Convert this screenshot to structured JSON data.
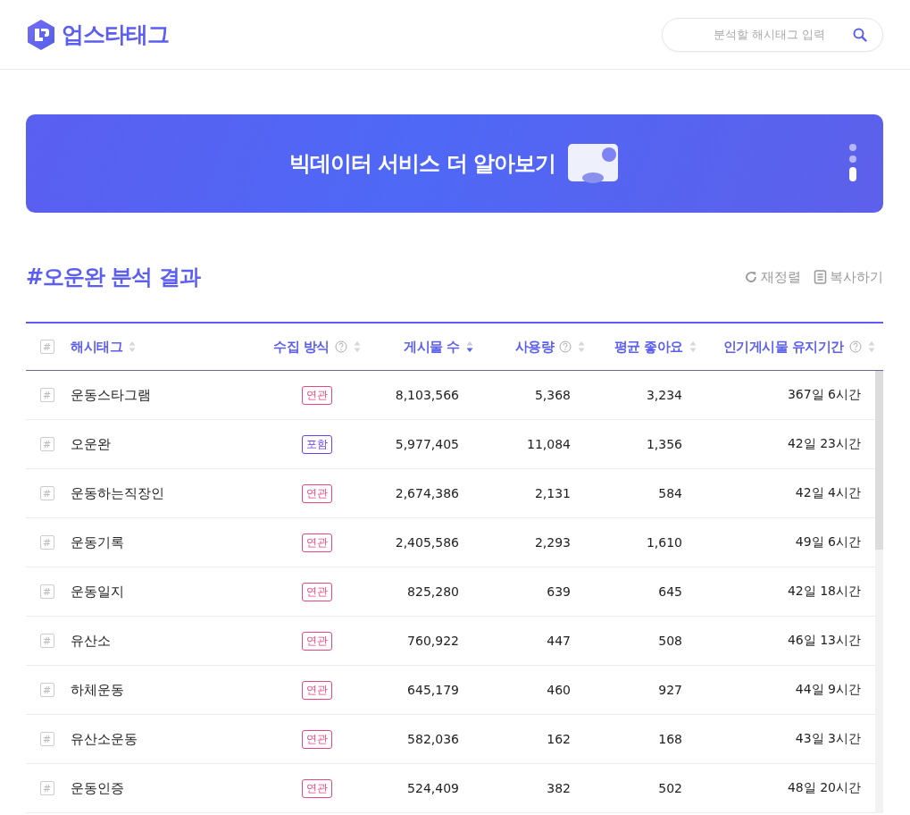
{
  "header": {
    "logo_text": "업스타태그",
    "search": {
      "placeholder": "분석할 해시태그 입력"
    }
  },
  "banner": {
    "text": "빅데이터 서비스 더 알아보기",
    "slides": [
      {
        "selected": false
      },
      {
        "selected": false
      },
      {
        "selected": true
      }
    ]
  },
  "result": {
    "title": "#오운완 분석 결과",
    "actions": [
      {
        "kind": "refresh",
        "label": "재정렬"
      },
      {
        "kind": "copy",
        "label": "복사하기"
      }
    ]
  },
  "table": {
    "mark": "#",
    "checked": false,
    "columns": [
      {
        "label": "해시태그",
        "help": false,
        "sorted": false
      },
      {
        "label": "수집 방식",
        "help": true,
        "sorted": false
      },
      {
        "label": "게시물 수",
        "help": false,
        "sorted": true
      },
      {
        "label": "사용량",
        "help": true,
        "sorted": false
      },
      {
        "label": "평균 좋아요",
        "help": false,
        "sorted": false
      },
      {
        "label": "인기게시물 유지기간",
        "help": true,
        "sorted": false
      }
    ],
    "rows": [
      {
        "mark": "#",
        "checked": false,
        "hashtag": "운동스타그램",
        "method": {
          "kind": "related",
          "label": "연관"
        },
        "posts": "8,103,566",
        "usage": "5,368",
        "likes": "3,234",
        "duration": "367일 6시간"
      },
      {
        "mark": "#",
        "checked": false,
        "hashtag": "오운완",
        "method": {
          "kind": "included",
          "label": "포함"
        },
        "posts": "5,977,405",
        "usage": "11,084",
        "likes": "1,356",
        "duration": "42일 23시간"
      },
      {
        "mark": "#",
        "checked": false,
        "hashtag": "운동하는직장인",
        "method": {
          "kind": "related",
          "label": "연관"
        },
        "posts": "2,674,386",
        "usage": "2,131",
        "likes": "584",
        "duration": "42일 4시간"
      },
      {
        "mark": "#",
        "checked": false,
        "hashtag": "운동기록",
        "method": {
          "kind": "related",
          "label": "연관"
        },
        "posts": "2,405,586",
        "usage": "2,293",
        "likes": "1,610",
        "duration": "49일 6시간"
      },
      {
        "mark": "#",
        "checked": false,
        "hashtag": "운동일지",
        "method": {
          "kind": "related",
          "label": "연관"
        },
        "posts": "825,280",
        "usage": "639",
        "likes": "645",
        "duration": "42일 18시간"
      },
      {
        "mark": "#",
        "checked": false,
        "hashtag": "유산소",
        "method": {
          "kind": "related",
          "label": "연관"
        },
        "posts": "760,922",
        "usage": "447",
        "likes": "508",
        "duration": "46일 13시간"
      },
      {
        "mark": "#",
        "checked": false,
        "hashtag": "하체운동",
        "method": {
          "kind": "related",
          "label": "연관"
        },
        "posts": "645,179",
        "usage": "460",
        "likes": "927",
        "duration": "44일 9시간"
      },
      {
        "mark": "#",
        "checked": false,
        "hashtag": "유산소운동",
        "method": {
          "kind": "related",
          "label": "연관"
        },
        "posts": "582,036",
        "usage": "162",
        "likes": "168",
        "duration": "43일 3시간"
      },
      {
        "mark": "#",
        "checked": false,
        "hashtag": "운동인증",
        "method": {
          "kind": "related",
          "label": "연관"
        },
        "posts": "524,409",
        "usage": "382",
        "likes": "502",
        "duration": "48일 20시간"
      }
    ]
  }
}
